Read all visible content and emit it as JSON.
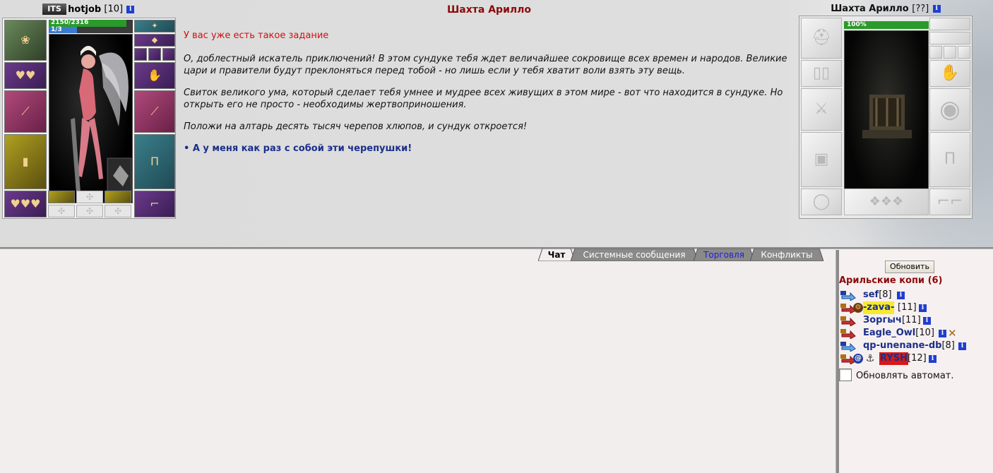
{
  "player": {
    "clan_tag": "ITS",
    "nick": "hotjob",
    "level": "[10]",
    "hp_text": "2150/2316",
    "hp_fraction": 0.928,
    "mp_text": "1/3",
    "mp_fraction": 0.333
  },
  "location": {
    "title": "Шахта Арилло"
  },
  "dialog": {
    "warning": "У вас уже есть такое задание",
    "paragraphs": [
      "О, доблестный искатель приключений! В этом сундуке тебя ждет величайшее сокровище всех времен и народов. Великие цари и правители будут преклоняться перед тобой - но лишь если у тебя хватит воли взять эту вещь.",
      "Свиток великого ума, который сделает тебя умнее и мудрее всех живущих в этом мире - вот что находится в сундуке. Но открыть его не просто - необходимы жертвоприношения.",
      "Положи на алтарь десять тысяч черепов хлюпов, и сундук откроется!"
    ],
    "action": "• А у меня как раз с собой эти черепушки!"
  },
  "target": {
    "name": "Шахта Арилло",
    "level": "[??]",
    "hp_text": "100%",
    "hp_fraction": 1.0
  },
  "chat": {
    "tabs": [
      "Чат",
      "Системные сообщения",
      "Торговля",
      "Конфликты"
    ],
    "active_tab": "Чат"
  },
  "online": {
    "refresh_label": "Обновить",
    "room_title": "Арильские копи (6)",
    "users": [
      {
        "nick": "sef",
        "level": "[8]"
      },
      {
        "nick": "-zava-",
        "level": "[11]"
      },
      {
        "nick": "Зоргыч",
        "level": "[11]"
      },
      {
        "nick": "Eagle_Owl",
        "level": "[10]"
      },
      {
        "nick": "qp-unenane-db",
        "level": "[8]"
      },
      {
        "nick": "RYSH",
        "level": "[12]"
      }
    ],
    "auto_refresh_label": "Обновлять автомат."
  },
  "colors": {
    "title_red": "#8b0a0a",
    "warning_red": "#d01010",
    "action_blue": "#1a2f8a",
    "hp_green": "#2a9a2a",
    "mp_blue": "#3a7ad0",
    "trade_tab_blue": "#2020e0"
  }
}
